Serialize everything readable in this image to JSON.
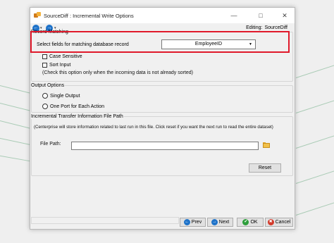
{
  "window": {
    "title": "SourceDiff : Incremental Write Options",
    "editing_label": "Editing:",
    "editing_value": "SourceDiff",
    "minimize_glyph": "—",
    "maximize_glyph": "□",
    "close_glyph": "✕"
  },
  "toolbar": {
    "back_glyph": "←",
    "forward_glyph": "→",
    "dropdown_glyph": "▾"
  },
  "record_matching": {
    "legend": "Record Matching",
    "select_label": "Select fields for matching database record",
    "selected_value": "EmployeeID",
    "case_sensitive_label": "Case Sensitive",
    "case_sensitive_checked": false,
    "sort_input_label": "Sort Input",
    "sort_input_checked": false,
    "sort_note": "(Check this option only when the incoming data is not already sorted)"
  },
  "output_options": {
    "legend": "Output Options",
    "single_output_label": "Single Output",
    "one_port_label": "One Port for Each Action"
  },
  "incremental": {
    "legend": "Incremental Transfer Information File Path",
    "note": "(Centerprise will store information related to last run in this file. Click reset if you want the next run to read the entire dataset)",
    "file_path_label": "File Path:",
    "file_path_value": "",
    "reset_label": "Reset"
  },
  "footer": {
    "prev_label": "Prev",
    "next_label": "Next",
    "ok_label": "OK",
    "cancel_label": "Cancel",
    "prev_glyph": "←",
    "next_glyph": "→",
    "ok_glyph": "✔",
    "cancel_glyph": "✖"
  },
  "colors": {
    "highlight_border": "#e0192b",
    "nav_blue": "#1f73c9",
    "ok_green": "#2e9e3b",
    "cancel_red": "#d23b2c"
  }
}
